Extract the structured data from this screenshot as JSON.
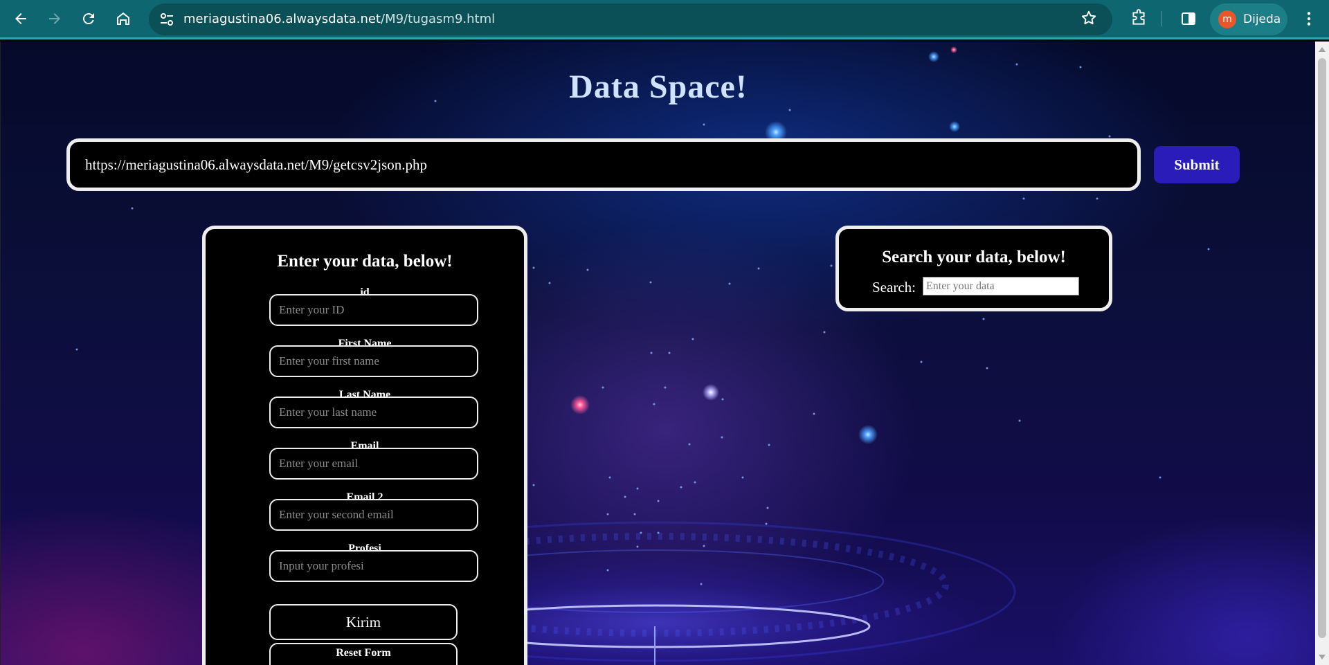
{
  "browser": {
    "url_host": "meriagustina06.alwaysdata.net",
    "url_path": "/M9/tugasm9.html",
    "profile_initial": "m",
    "profile_name": "Dijeda"
  },
  "page": {
    "title": "Data Space!",
    "source_url": "https://meriagustina06.alwaysdata.net/M9/getcsv2json.php",
    "submit_label": "Submit"
  },
  "form": {
    "heading": "Enter your data, below!",
    "fields": [
      {
        "label": "id",
        "placeholder": "Enter your ID"
      },
      {
        "label": "First Name",
        "placeholder": "Enter your first name"
      },
      {
        "label": "Last Name",
        "placeholder": "Enter your last name"
      },
      {
        "label": "Email",
        "placeholder": "Enter your email"
      },
      {
        "label": "Email 2",
        "placeholder": "Enter your second email"
      },
      {
        "label": "Profesi",
        "placeholder": "Input your profesi"
      }
    ],
    "send_label": "Kirim",
    "reset_label": "Reset Form"
  },
  "search": {
    "heading": "Search your data, below!",
    "label": "Search:",
    "placeholder": "Enter your data"
  },
  "colors": {
    "chrome_bar": "#0e6670",
    "omnibox": "#0b4f57",
    "submit_button": "#2a1cb8",
    "title_text": "#cfe2ff",
    "avatar": "#e8562a"
  }
}
